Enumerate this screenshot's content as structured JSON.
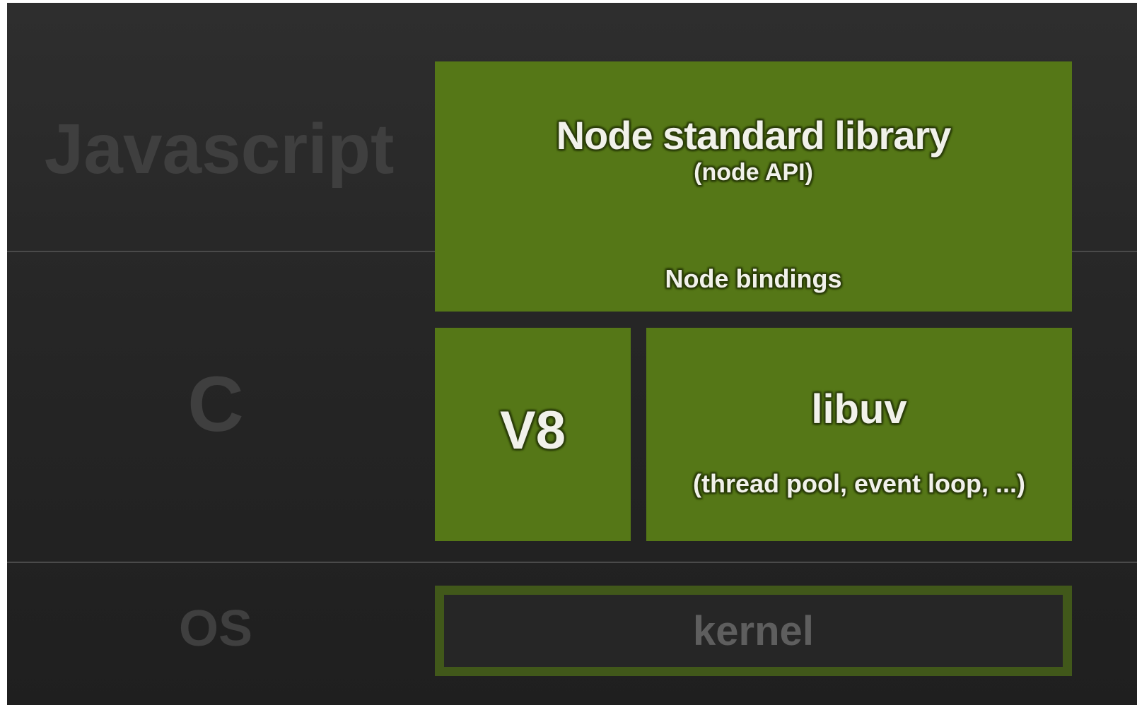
{
  "layers": {
    "javascript": "Javascript",
    "c": "C",
    "os": "OS"
  },
  "blocks": {
    "node_standard_library": {
      "title": "Node standard library",
      "subtitle": "(node API)",
      "bindings": "Node bindings"
    },
    "v8": {
      "title": "V8"
    },
    "libuv": {
      "title": "libuv",
      "subtitle": "(thread pool, event loop, ...)"
    },
    "kernel": {
      "title": "kernel"
    }
  },
  "colors": {
    "background": "#2b2b2b",
    "block_green": "#557717",
    "kernel_border": "#41581a",
    "layer_label": "#3f3f3f",
    "block_text": "#f1f1ea",
    "kernel_text": "#5e5e5e"
  }
}
